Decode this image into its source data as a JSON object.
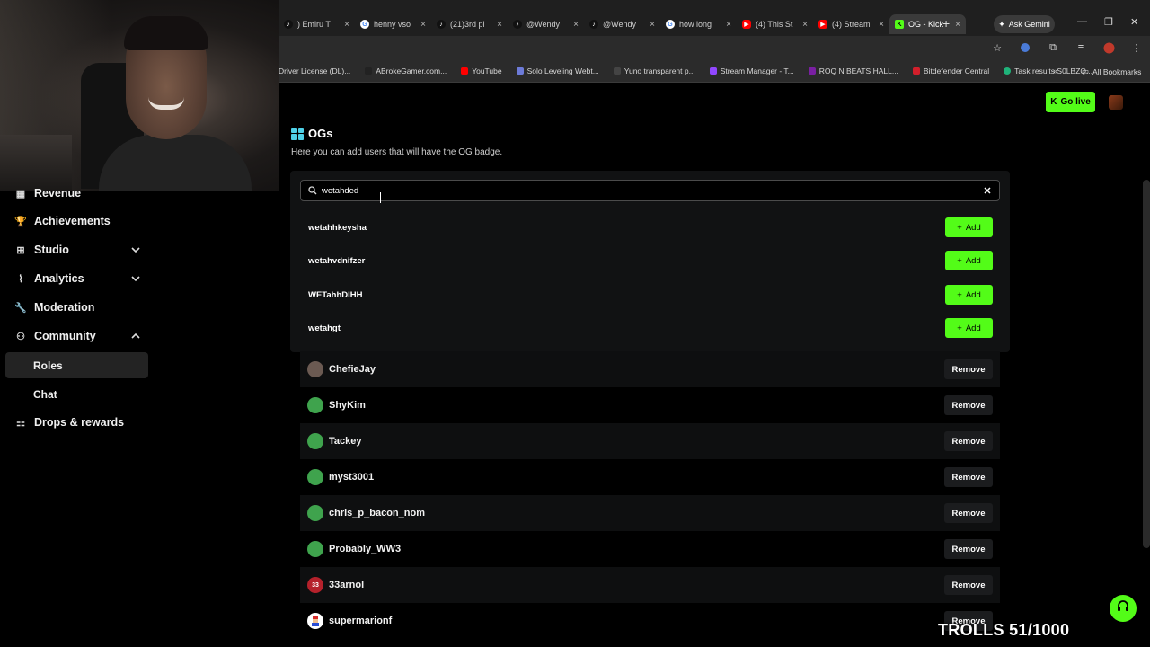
{
  "browser": {
    "tabs": [
      {
        "label": ") Emiru T",
        "favicon": "tiktok-icon"
      },
      {
        "label": "henny vso",
        "favicon": "google-icon"
      },
      {
        "label": "(21)3rd pl",
        "favicon": "tiktok-icon"
      },
      {
        "label": "@Wendy",
        "favicon": "tiktok-icon"
      },
      {
        "label": "@Wendy",
        "favicon": "tiktok-icon"
      },
      {
        "label": "how long",
        "favicon": "google-icon"
      },
      {
        "label": "(4) This St",
        "favicon": "youtube-icon"
      },
      {
        "label": "(4) Stream",
        "favicon": "youtube-icon"
      },
      {
        "label": "OG - Kick",
        "favicon": "kick-icon",
        "active": true
      }
    ],
    "gemini_label": "Ask Gemini",
    "bookmarks": [
      "Driver License (DL)...",
      "ABrokeGamer.com...",
      "YouTube",
      "Solo Leveling Webt...",
      "Yuno transparent p...",
      "Stream Manager - T...",
      "ROQ N BEATS HALL...",
      "Bitdefender Central",
      "Task results S0LBZQ..."
    ],
    "all_bookmarks": "All Bookmarks"
  },
  "sidebar": {
    "items": [
      {
        "label": "Revenue",
        "icon": "revenue-icon"
      },
      {
        "label": "Achievements",
        "icon": "trophy-icon"
      },
      {
        "label": "Studio",
        "icon": "grid-icon",
        "chevron": "down"
      },
      {
        "label": "Analytics",
        "icon": "chart-icon",
        "chevron": "down"
      },
      {
        "label": "Moderation",
        "icon": "wrench-icon"
      },
      {
        "label": "Community",
        "icon": "users-icon",
        "chevron": "up"
      }
    ],
    "sub_items": [
      "Roles",
      "Chat"
    ],
    "drops": {
      "label": "Drops & rewards",
      "icon": "gift-icon"
    }
  },
  "header": {
    "go_live": "Go live"
  },
  "og": {
    "title": "OGs",
    "description": "Here you can add users that will have the OG badge.",
    "search_value": "wetahded",
    "results": [
      "wetahhkeysha",
      "wetahvdnifzer",
      "WETahhDIHH",
      "wetahgt"
    ],
    "add_label": "Add",
    "remove_label": "Remove",
    "users": [
      {
        "name": "ChefieJay",
        "avatar": "#6b5a52"
      },
      {
        "name": "ShyKim",
        "avatar": "#3fa34d"
      },
      {
        "name": "Tackey",
        "avatar": "#3fa34d"
      },
      {
        "name": "myst3001",
        "avatar": "#3fa34d"
      },
      {
        "name": "chris_p_bacon_nom",
        "avatar": "#3fa34d"
      },
      {
        "name": "Probably_WW3",
        "avatar": "#3fa34d"
      },
      {
        "name": "33arnol",
        "avatar": "#b5212b",
        "badge": "33"
      },
      {
        "name": "supermarionf",
        "avatar": "#ffffff"
      }
    ]
  },
  "overlay": {
    "text": "TROLLS 51/1000"
  },
  "colors": {
    "kick_green": "#53fc18",
    "og_icon": "#4fd1e8"
  }
}
